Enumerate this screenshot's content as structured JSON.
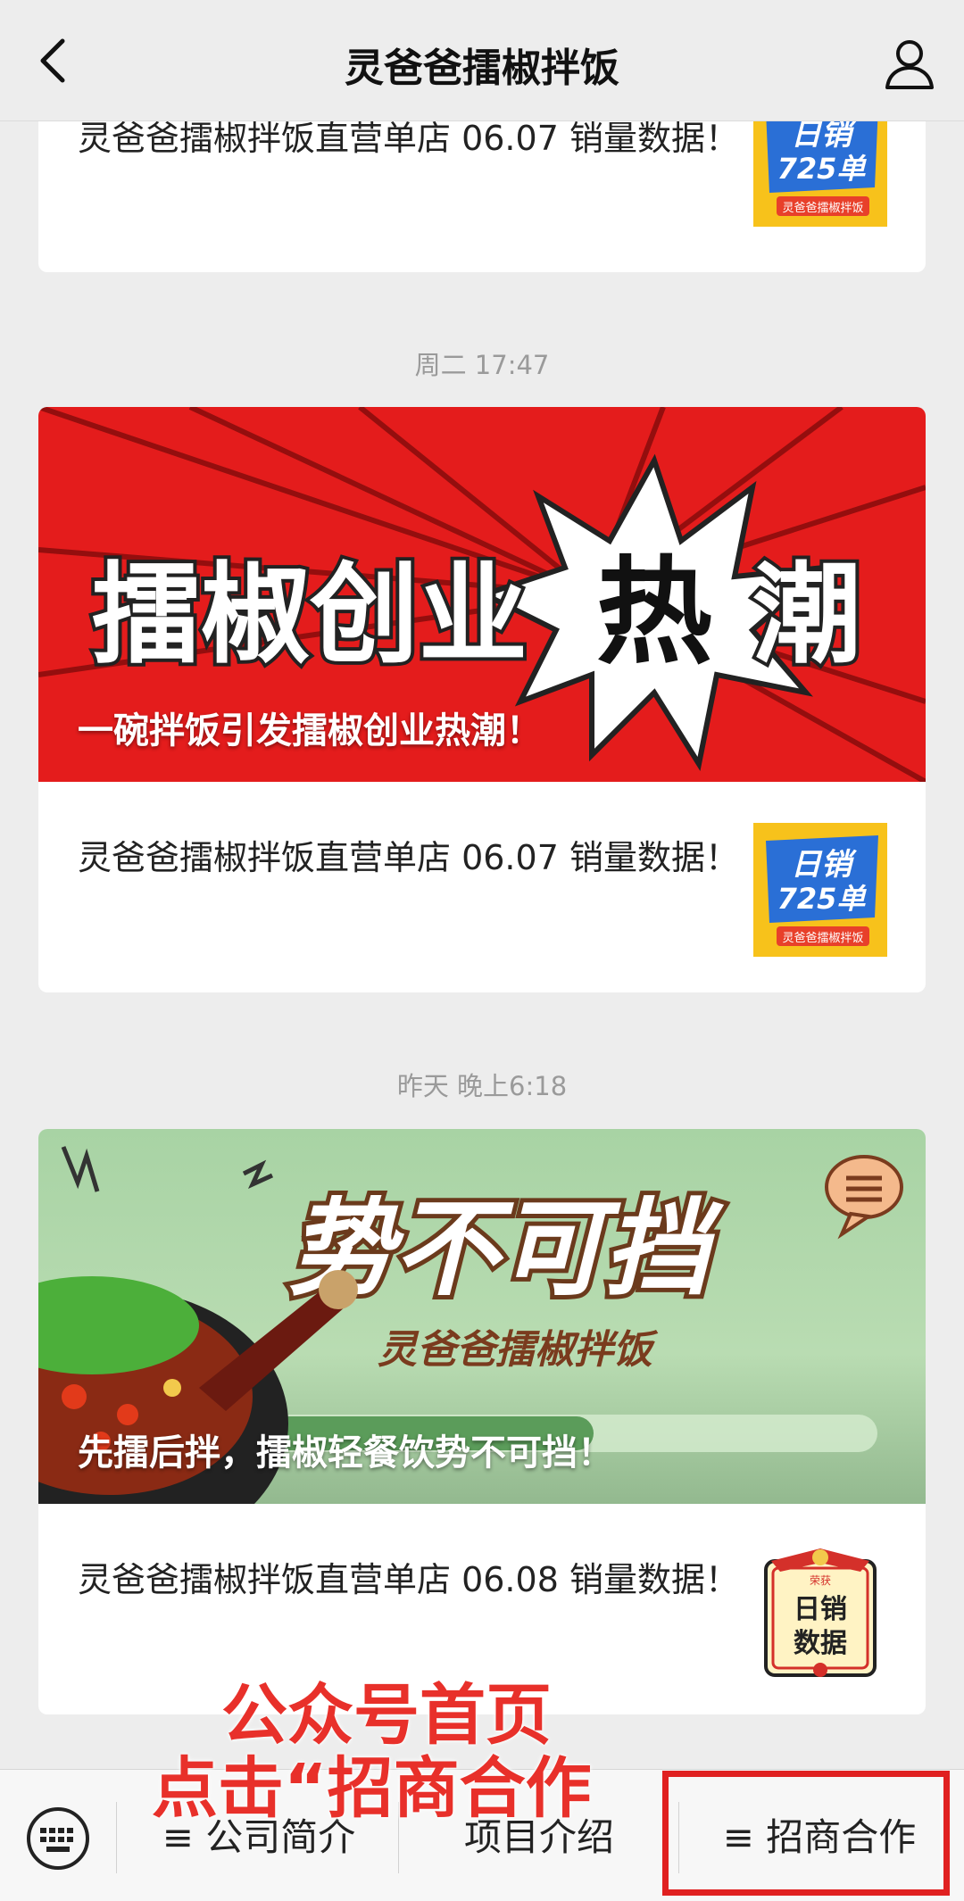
{
  "header": {
    "title": "灵爸爸擂椒拌饭"
  },
  "feed": {
    "card1": {
      "row_text": "灵爸爸擂椒拌饭直营单店 06.07 销量数据！",
      "thumb_text_top": "日销",
      "thumb_text_bottom": "725单",
      "thumb_brand": "灵爸爸擂椒拌饭"
    },
    "timestamp2": "周二 17:47",
    "card2": {
      "cover_headline_a": "擂椒创业",
      "cover_headline_b": "热",
      "cover_headline_c": "潮",
      "cover_caption": "一碗拌饭引发擂椒创业热潮！",
      "row_text": "灵爸爸擂椒拌饭直营单店 06.07 销量数据！",
      "thumb_text_top": "日销",
      "thumb_text_bottom": "725单",
      "thumb_brand": "灵爸爸擂椒拌饭"
    },
    "timestamp3": "昨天 晚上6:18",
    "card3": {
      "cover_headline": "势不可挡",
      "cover_subtitle": "灵爸爸擂椒拌饭",
      "cover_caption": "先擂后拌，擂椒轻餐饮势不可挡！",
      "row_text": "灵爸爸擂椒拌饭直营单店 06.08 销量数据！",
      "thumb_label_small": "荣获",
      "thumb_line1": "日销",
      "thumb_line2": "数据"
    }
  },
  "annotation": {
    "line1": "公众号首页",
    "line2": "点击“招商合作"
  },
  "menu": {
    "item1": "≡ 公司简介",
    "item2": "项目介绍",
    "item3": "≡ 招商合作"
  },
  "colors": {
    "accent_red": "#e02020",
    "background": "#ededed"
  }
}
